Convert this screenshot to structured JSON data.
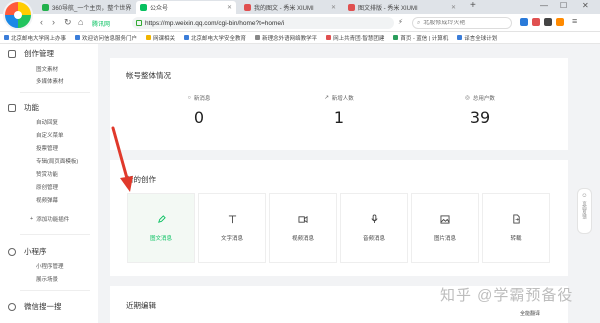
{
  "tabs": [
    {
      "label": "360导航_一个主页，整个世界",
      "active": false,
      "favicon_color": "#22b14c"
    },
    {
      "label": "公众号",
      "active": true,
      "favicon_color": "#07c160"
    },
    {
      "label": "我的图文 - 秀米 XIUMI",
      "active": false,
      "favicon_color": "#e05050"
    },
    {
      "label": "图文排版 - 秀米 XIUMI",
      "active": false,
      "favicon_color": "#e05050"
    }
  ],
  "address": {
    "url": "https://mp.weixin.qq.com/cgi-bin/home?t=home/i",
    "secure_label": "腾讯网",
    "search_placeholder": "北股修成玲灭艳"
  },
  "bookmarks": [
    "北京邮电大学网上办事",
    "欢迎访问信息服务门户",
    "网课相关",
    "北京邮电大学安全教育",
    "新理念外语网络教学平",
    "网上共青团·智慧团建",
    "首页 - 蓝信 | 计算机",
    "译言全球计划"
  ],
  "sidebar": {
    "groups": [
      {
        "label": "创作管理",
        "items": [
          "图文素材",
          "多媒体素材"
        ]
      },
      {
        "label": "功能",
        "items": [
          "自动回复",
          "自定义菜单",
          "投票管理",
          "专辑(局页面模板)",
          "赞赏功能",
          "原创管理",
          "视频弹幕"
        ],
        "add_label": "添加功能插件"
      },
      {
        "label": "小程序",
        "items": [
          "小程序管理",
          "展示场景"
        ]
      },
      {
        "label": "微信搜一搜",
        "items": []
      }
    ]
  },
  "overview": {
    "title": "帐号整体情况",
    "stats": [
      {
        "label": "新消息",
        "value": "0",
        "icon": "circle-icon"
      },
      {
        "label": "新增人数",
        "value": "1",
        "icon": "trend-icon"
      },
      {
        "label": "总用户数",
        "value": "39",
        "icon": "user-icon"
      }
    ]
  },
  "create": {
    "title": "新的创作",
    "items": [
      {
        "label": "图文消息",
        "icon": "pencil-icon"
      },
      {
        "label": "文字消息",
        "icon": "text-icon"
      },
      {
        "label": "视频消息",
        "icon": "video-icon"
      },
      {
        "label": "音频消息",
        "icon": "mic-icon"
      },
      {
        "label": "图片消息",
        "icon": "image-icon"
      },
      {
        "label": "转载",
        "icon": "repost-icon"
      }
    ]
  },
  "recent": {
    "title": "近期编辑"
  },
  "float_tab": {
    "label": "页面反馈"
  },
  "watermark": "知乎 @学霸预备役",
  "footer_tip": "全能翻译",
  "colors": {
    "accent": "#07c160",
    "arrow": "#e0392b"
  }
}
